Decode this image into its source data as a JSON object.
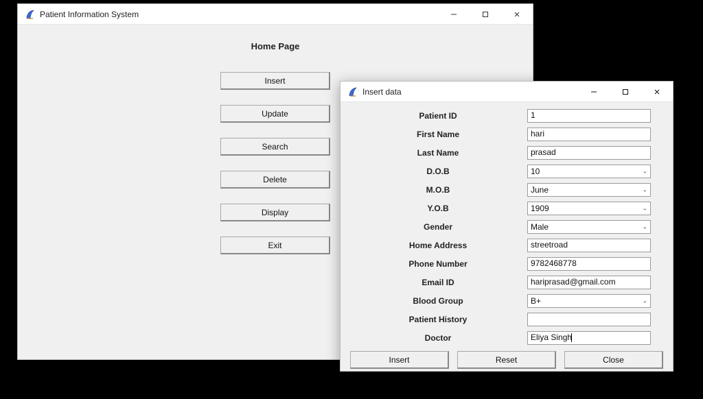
{
  "main_window": {
    "title": "Patient Information System",
    "heading": "Home Page",
    "buttons": {
      "insert": "Insert",
      "update": "Update",
      "search": "Search",
      "delete": "Delete",
      "display": "Display",
      "exit": "Exit"
    }
  },
  "dialog": {
    "title": "Insert data",
    "fields": {
      "patient_id": {
        "label": "Patient ID",
        "value": "1",
        "type": "text"
      },
      "first_name": {
        "label": "First Name",
        "value": "hari",
        "type": "text"
      },
      "last_name": {
        "label": "Last Name",
        "value": "prasad",
        "type": "text"
      },
      "dob": {
        "label": "D.O.B",
        "value": "10",
        "type": "combo"
      },
      "mob": {
        "label": "M.O.B",
        "value": "June",
        "type": "combo"
      },
      "yob": {
        "label": "Y.O.B",
        "value": "1909",
        "type": "combo"
      },
      "gender": {
        "label": "Gender",
        "value": "Male",
        "type": "combo"
      },
      "home_address": {
        "label": "Home Address",
        "value": "streetroad",
        "type": "text"
      },
      "phone_number": {
        "label": "Phone Number",
        "value": "9782468778",
        "type": "text"
      },
      "email_id": {
        "label": "Email ID",
        "value": "hariprasad@gmail.com",
        "type": "text"
      },
      "blood_group": {
        "label": "Blood Group",
        "value": "B+",
        "type": "combo"
      },
      "patient_history": {
        "label": "Patient History",
        "value": "",
        "type": "text"
      },
      "doctor": {
        "label": "Doctor",
        "value": "Eliya Singh",
        "type": "text",
        "focused": true
      }
    },
    "buttons": {
      "insert": "Insert",
      "reset": "Reset",
      "close": "Close"
    }
  }
}
